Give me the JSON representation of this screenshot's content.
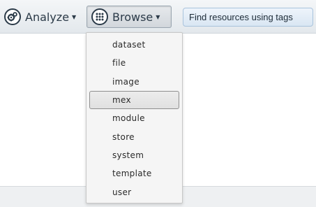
{
  "toolbar": {
    "analyze_label": "Analyze",
    "browse_label": "Browse",
    "search_placeholder": "Find resources using tags"
  },
  "browse_menu": {
    "items": [
      {
        "label": "dataset",
        "selected": false
      },
      {
        "label": "file",
        "selected": false
      },
      {
        "label": "image",
        "selected": false
      },
      {
        "label": "mex",
        "selected": true
      },
      {
        "label": "module",
        "selected": false
      },
      {
        "label": "store",
        "selected": false
      },
      {
        "label": "system",
        "selected": false
      },
      {
        "label": "template",
        "selected": false
      },
      {
        "label": "user",
        "selected": false
      }
    ]
  },
  "colors": {
    "toolbar_text": "#2b3a48",
    "search_bg": "#d9e6f3",
    "menu_bg": "#f5f5f5"
  },
  "icons": {
    "analyze": "gears-icon",
    "browse": "grid-icon",
    "caret": "caret-down-icon"
  }
}
